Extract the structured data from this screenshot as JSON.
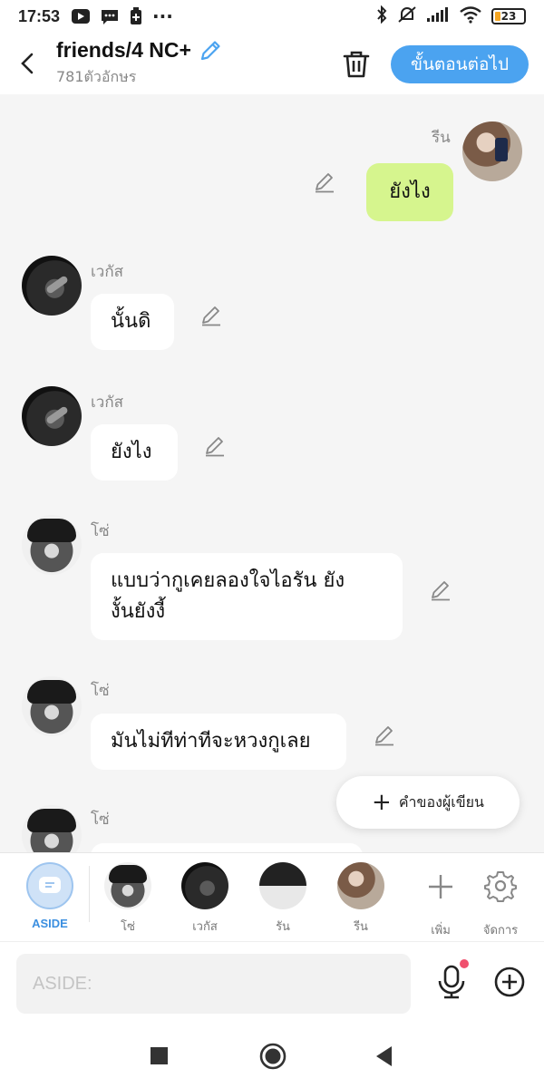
{
  "status_bar": {
    "time": "17:53",
    "battery": "23"
  },
  "header": {
    "title": "friends/4 NC+",
    "subtitle": "781ตัวอักษร",
    "next_button": "ขั้นตอนต่อไป"
  },
  "messages": [
    {
      "sender": "รีน",
      "text": "ยังไง",
      "side": "right"
    },
    {
      "sender": "เวกัส",
      "text": "นั้นดิ",
      "side": "left"
    },
    {
      "sender": "เวกัส",
      "text": "ยังไง",
      "side": "left"
    },
    {
      "sender": "โซ่",
      "text_line1": "แบบว่ากูเคยลองใจไอรัน ยัง",
      "text_line2": "งั้นยังงี้",
      "side": "left"
    },
    {
      "sender": "โซ่",
      "text": "มันไม่ทีท่าทีจะหวงกูเลย",
      "side": "left"
    },
    {
      "sender": "โซ่",
      "text": "",
      "side": "left"
    }
  ],
  "fab": {
    "label": "คำของผู้เขียน"
  },
  "characters": [
    {
      "label": "ASIDE"
    },
    {
      "label": "โซ่"
    },
    {
      "label": "เวกัส"
    },
    {
      "label": "รัน"
    },
    {
      "label": "รีน"
    }
  ],
  "actions": {
    "add_label": "เพิ่ม",
    "manage_label": "จัดการ"
  },
  "input": {
    "placeholder": "ASIDE:"
  },
  "colors": {
    "accent": "#4ba3f0",
    "own_bubble": "#d6f58e",
    "mic_dot": "#f0506e"
  }
}
